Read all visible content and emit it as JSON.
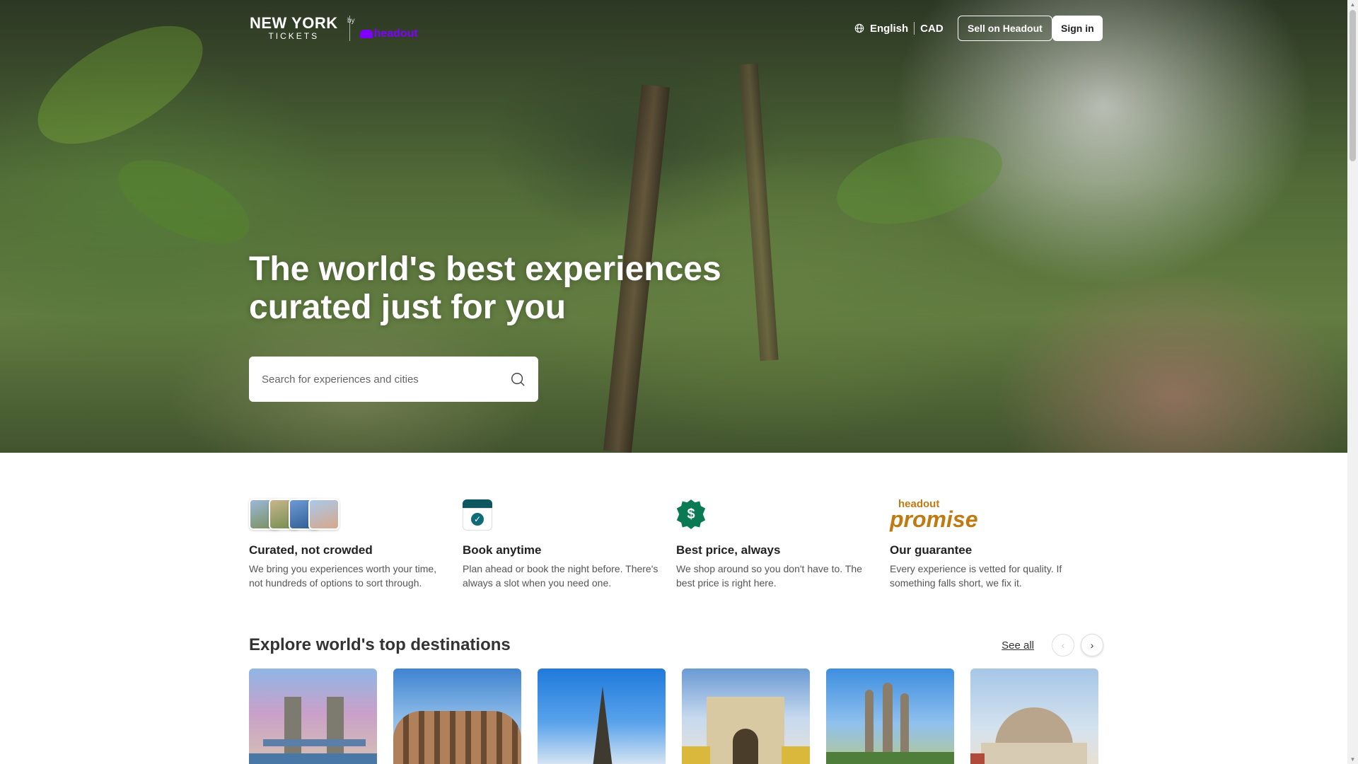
{
  "header": {
    "logo_title": "NEW YORK",
    "logo_subtitle": "TICKETS",
    "logo_by": "by",
    "partner": "headout",
    "language": "English",
    "currency": "CAD",
    "sell_label": "Sell on Headout",
    "signin_label": "Sign in"
  },
  "hero": {
    "title": "The world's best experiences curated just for you",
    "search_placeholder": "Search for experiences and cities"
  },
  "features": [
    {
      "title": "Curated, not crowded",
      "text": "We bring you experiences worth your time, not hundreds of options to sort through.",
      "icon": "photo-stack-icon"
    },
    {
      "title": "Book anytime",
      "text": "Plan ahead or book the night before. There's always a slot when you need one.",
      "icon": "calendar-check-icon"
    },
    {
      "title": "Best price, always",
      "text": "We shop around so you don't have to. The best price is right here.",
      "icon": "dollar-badge-icon"
    },
    {
      "title": "Our guarantee",
      "text": "Every experience is vetted for quality. If something falls short, we fix it.",
      "icon": "headout-promise-logo",
      "logo_small": "headout",
      "logo_big": "promise"
    }
  ],
  "destinations": {
    "heading": "Explore world's top destinations",
    "see_all": "See all",
    "cards": [
      {
        "name": "tower-bridge",
        "accent": "#6aa0d8"
      },
      {
        "name": "colosseum",
        "accent": "#5a95d6"
      },
      {
        "name": "eiffel-tower",
        "accent": "#3d8de0"
      },
      {
        "name": "lisbon-arch",
        "accent": "#7aa6d4"
      },
      {
        "name": "sagrada-familia",
        "accent": "#4f93da"
      },
      {
        "name": "naples-basilica",
        "accent": "#8fb3d9"
      }
    ]
  },
  "colors": {
    "brand_purple": "#8000ff",
    "promise_gold": "#c07a12",
    "teal": "#0f5760",
    "green_badge": "#0a7a55"
  }
}
